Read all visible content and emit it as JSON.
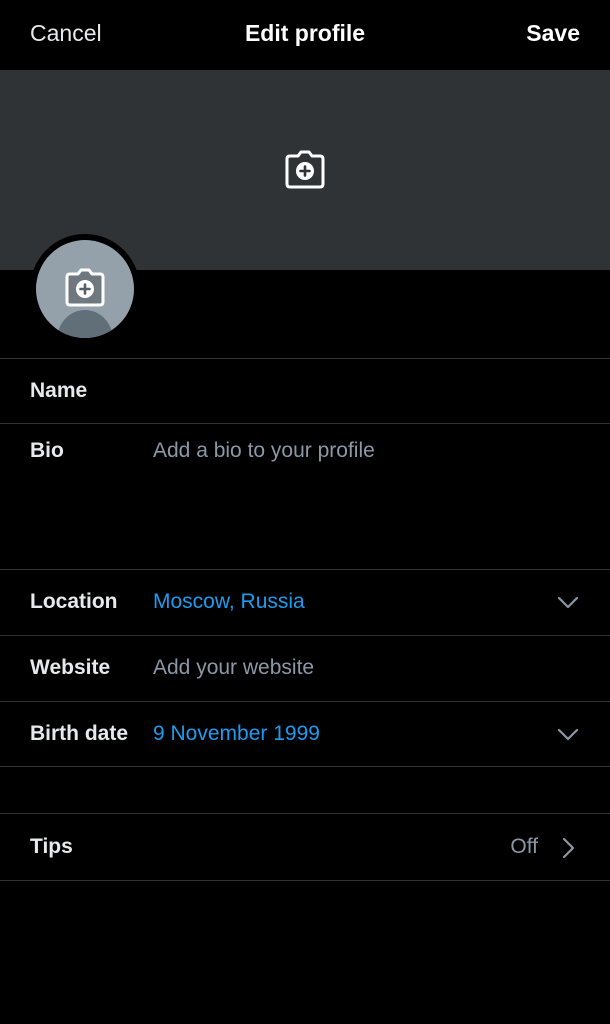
{
  "header": {
    "cancel_label": "Cancel",
    "title": "Edit profile",
    "save_label": "Save"
  },
  "banner": {
    "icon": "camera-plus-icon"
  },
  "avatar": {
    "icon": "camera-plus-icon"
  },
  "fields": {
    "name": {
      "label": "Name",
      "value": ""
    },
    "bio": {
      "label": "Bio",
      "placeholder": "Add a bio to your profile"
    },
    "location": {
      "label": "Location",
      "value": "Moscow, Russia",
      "icon": "chevron-down-icon"
    },
    "website": {
      "label": "Website",
      "placeholder": "Add your website"
    },
    "birth_date": {
      "label": "Birth date",
      "value": "9 November 1999",
      "icon": "chevron-down-icon"
    }
  },
  "tips": {
    "label": "Tips",
    "value": "Off",
    "icon": "chevron-right-icon"
  },
  "colors": {
    "background": "#000000",
    "banner": "#2f3336",
    "accent": "#1d9bf0",
    "placeholder": "#8b98a5",
    "divider": "#2f3336"
  }
}
